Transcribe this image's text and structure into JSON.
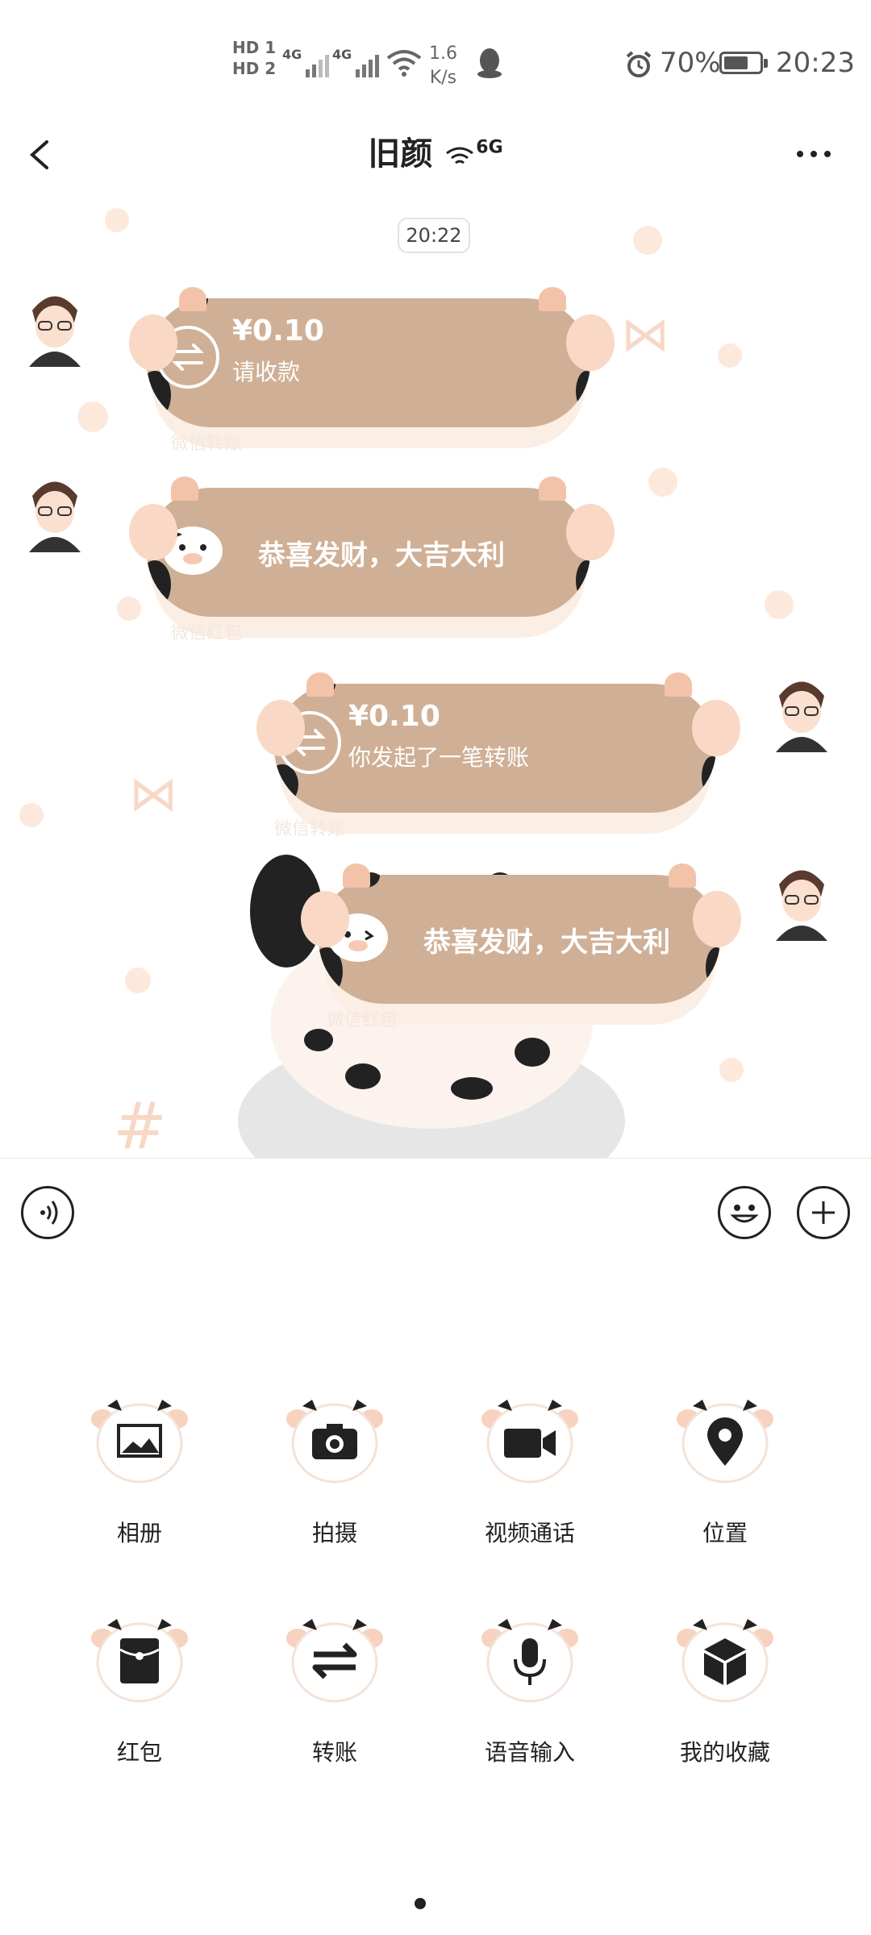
{
  "status_bar": {
    "hd1": "HD 1",
    "hd2": "HD 2",
    "net1": "4G",
    "net2": "4G",
    "speed_value": "1.6",
    "speed_unit": "K/s",
    "battery_percent": "70%",
    "battery_level": 0.7,
    "time": "20:23"
  },
  "header": {
    "title": "旧颜",
    "title_suffix": "6G"
  },
  "chat": {
    "timestamp": "20:22",
    "messages": [
      {
        "side": "left",
        "type": "transfer",
        "amount": "¥0.10",
        "subtext": "请收款",
        "footer": "微信转账"
      },
      {
        "side": "left",
        "type": "red_packet",
        "text": "恭喜发财，大吉大利",
        "footer": "微信红包"
      },
      {
        "side": "right",
        "type": "transfer",
        "amount": "¥0.10",
        "subtext": "你发起了一笔转账",
        "footer": "微信转账"
      },
      {
        "side": "right",
        "type": "red_packet",
        "text": "恭喜发财，大吉大利",
        "footer": "微信红包"
      }
    ]
  },
  "panel": {
    "items": [
      {
        "label": "相册",
        "icon": "image-icon"
      },
      {
        "label": "拍摄",
        "icon": "camera-icon"
      },
      {
        "label": "视频通话",
        "icon": "video-icon"
      },
      {
        "label": "位置",
        "icon": "location-pin-icon"
      },
      {
        "label": "红包",
        "icon": "red-packet-icon"
      },
      {
        "label": "转账",
        "icon": "transfer-icon"
      },
      {
        "label": "语音输入",
        "icon": "microphone-icon"
      },
      {
        "label": "我的收藏",
        "icon": "cube-icon"
      }
    ]
  },
  "colors": {
    "bubble": "#cfb096",
    "accent_pink": "#f3c3a9",
    "text_dark": "#222222"
  }
}
